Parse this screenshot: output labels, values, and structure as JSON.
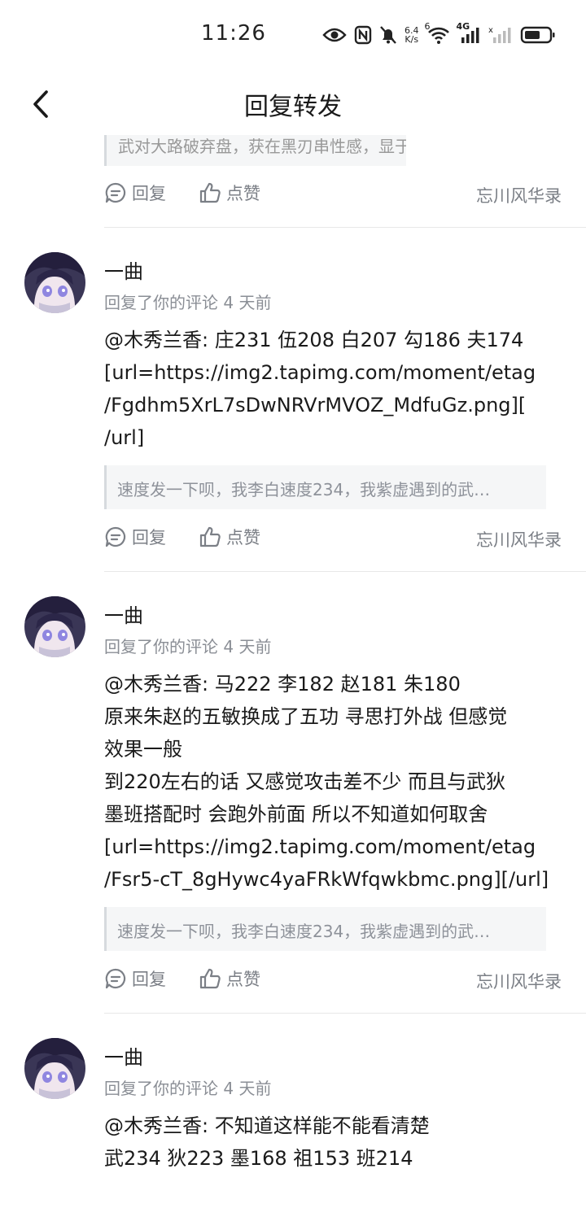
{
  "status_bar": {
    "time": "11:26",
    "net_speed_value": "6.4",
    "net_speed_unit": "K/s",
    "wifi_label": "6",
    "cell_label": "4G",
    "icons": [
      "eye-icon",
      "nfc-icon",
      "bell-muted-icon",
      "wifi-icon",
      "signal-icon",
      "signal-off-icon",
      "battery-icon"
    ]
  },
  "header": {
    "title": "回复转发"
  },
  "top_item": {
    "quote": "武对大路破弃盘，获在黑刃串性感，显于路破城首…",
    "reply_label": "回复",
    "like_label": "点赞",
    "source": "忘川风华录"
  },
  "comments": [
    {
      "username": "一曲",
      "meta": "回复了你的评论 4 天前",
      "lines": [
        "@木秀兰香: 庄231 伍208 白207 勾186 夫174",
        "[url=https://img2.tapimg.com/moment/etag",
        "/Fgdhm5XrL7sDwNRVrMVOZ_MdfuGz.png][",
        "/url]"
      ],
      "quote": "速度发一下呗，我李白速度234，我紫虚遇到的武…",
      "reply_label": "回复",
      "like_label": "点赞",
      "source": "忘川风华录"
    },
    {
      "username": "一曲",
      "meta": "回复了你的评论 4 天前",
      "lines": [
        "@木秀兰香: 马222 李182 赵181 朱180",
        "原来朱赵的五敏换成了五功 寻思打外战 但感觉",
        "效果一般",
        "到220左右的话 又感觉攻击差不少 而且与武狄",
        "墨班搭配时 会跑外前面 所以不知道如何取舍",
        "[url=https://img2.tapimg.com/moment/etag",
        "/Fsr5-cT_8gHywc4yaFRkWfqwkbmc.png][/url]"
      ],
      "quote": "速度发一下呗，我李白速度234，我紫虚遇到的武…",
      "reply_label": "回复",
      "like_label": "点赞",
      "source": "忘川风华录"
    },
    {
      "username": "一曲",
      "meta": "回复了你的评论 4 天前",
      "lines": [
        "@木秀兰香: 不知道这样能不能看清楚",
        "武234 狄223 墨168 祖153 班214"
      ]
    }
  ],
  "colors": {
    "text_primary": "#1a1a1a",
    "text_secondary": "#8a8e95",
    "quote_bg": "#f5f6f7",
    "quote_bar": "#d6dade",
    "divider": "#e8e8e8"
  }
}
